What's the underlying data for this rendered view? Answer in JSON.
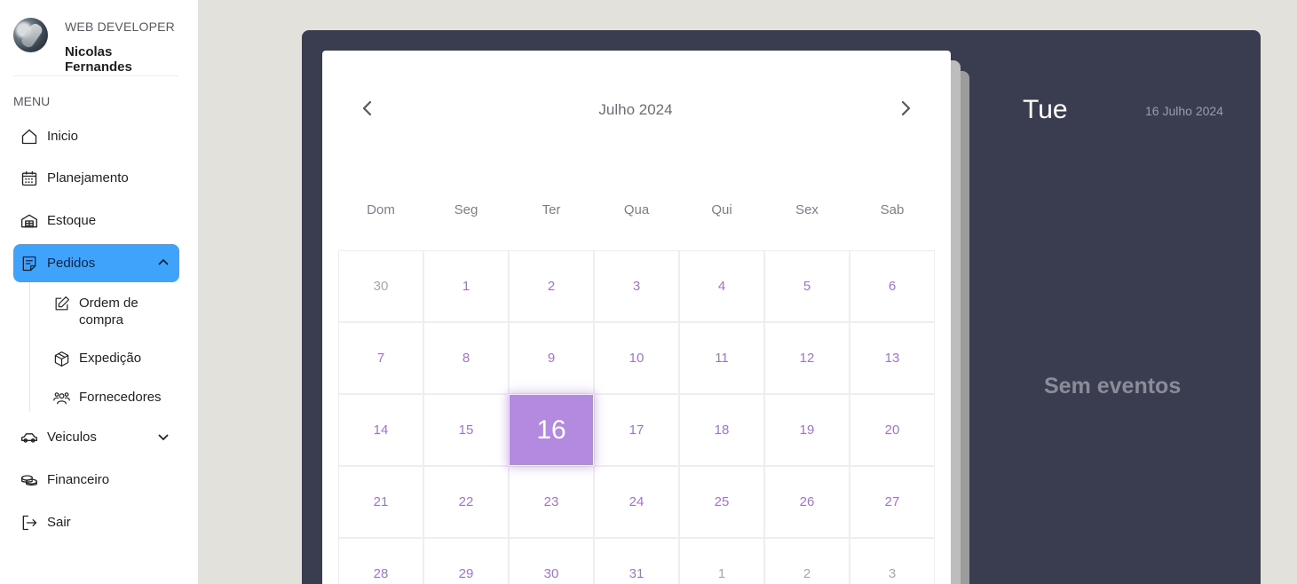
{
  "profile": {
    "role": "WEB DEVELOPER",
    "name": "Nicolas Fernandes"
  },
  "menu": {
    "title": "MENU",
    "items": [
      {
        "label": "Inicio",
        "icon": "home-icon"
      },
      {
        "label": "Planejamento",
        "icon": "calendar-icon"
      },
      {
        "label": "Estoque",
        "icon": "warehouse-icon"
      },
      {
        "label": "Pedidos",
        "icon": "order-icon",
        "active": true,
        "expanded": true
      },
      {
        "label": "Veiculos",
        "icon": "car-icon"
      },
      {
        "label": "Financeiro",
        "icon": "coins-icon"
      },
      {
        "label": "Sair",
        "icon": "logout-icon"
      }
    ],
    "subitems": [
      {
        "label": "Ordem de compra",
        "icon": "edit-icon"
      },
      {
        "label": "Expedição",
        "icon": "box-icon"
      },
      {
        "label": "Fornecedores",
        "icon": "users-icon"
      }
    ]
  },
  "calendar": {
    "month_label": "Julho 2024",
    "weekdays": [
      "Dom",
      "Seg",
      "Ter",
      "Qua",
      "Qui",
      "Sex",
      "Sab"
    ],
    "days": [
      [
        "30",
        "1",
        "2",
        "3",
        "4",
        "5",
        "6"
      ],
      [
        "7",
        "8",
        "9",
        "10",
        "11",
        "12",
        "13"
      ],
      [
        "14",
        "15",
        "16",
        "17",
        "18",
        "19",
        "20"
      ],
      [
        "21",
        "22",
        "23",
        "24",
        "25",
        "26",
        "27"
      ],
      [
        "28",
        "29",
        "30",
        "31",
        "1",
        "2",
        "3"
      ]
    ],
    "selected_day": "16"
  },
  "events_panel": {
    "day_name": "Tue",
    "full_date": "16 Julho 2024",
    "empty_text": "Sem eventos"
  },
  "colors": {
    "accent_blue": "#3fa3fb",
    "accent_purple": "#b48ae0",
    "day_text": "#a173cf",
    "panel_bg": "#3a3d50",
    "page_bg": "#e3e1dc"
  }
}
